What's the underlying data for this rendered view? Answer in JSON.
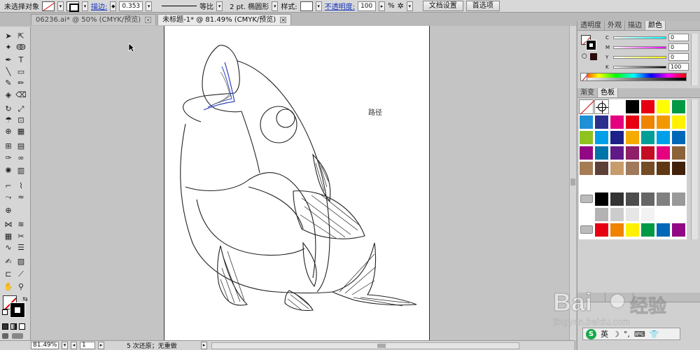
{
  "control_bar": {
    "selection_status": "未选择对象",
    "stroke_label": "描边:",
    "stroke_weight": "0.353",
    "stroke_style": "等比",
    "brush_size": "2 pt. 椭圆形",
    "style_label": "样式:",
    "opacity_label": "不透明度:",
    "opacity_value": "100",
    "opacity_unit": "%",
    "doc_setup_button": "文档设置",
    "preferences_button": "首选项"
  },
  "doc_tabs": [
    {
      "label": "06236.ai* @ 50% (CMYK/预览)",
      "active": false
    },
    {
      "label": "未标题-1* @ 81.49% (CMYK/预览)",
      "active": true
    }
  ],
  "canvas": {
    "path_label": "路径"
  },
  "status_bar": {
    "zoom": "81.49%",
    "page": "1",
    "message": "5 次还原；无重做"
  },
  "panels": {
    "top_tabs": [
      "透明度",
      "外观",
      "描边",
      "颜色"
    ],
    "color_channels": [
      {
        "label": "C",
        "value": "0"
      },
      {
        "label": "M",
        "value": "0"
      },
      {
        "label": "Y",
        "value": "0"
      },
      {
        "label": "K",
        "value": "100"
      }
    ],
    "pct": "%",
    "swatch_tabs": [
      "渐变",
      "色板"
    ],
    "swatch_colors": [
      "#ffffff",
      "#000000",
      "#e60012",
      "#ffff00",
      "#009944",
      "#1e90d6",
      "#2b2e8c",
      "#e4007f",
      "#e60012",
      "#f08300",
      "#f29900",
      "#fff100",
      "#8fc31f",
      "#00a0e9",
      "#1d2088",
      "#f6ab00",
      "#009e96",
      "#00a0e9",
      "#0068b7",
      "#920783",
      "#0075a9",
      "#601986",
      "#8e1f68",
      "#c30d23",
      "#e4007f",
      "#8c6239",
      "#a67c52",
      "#5d4037",
      "#c69c6d",
      "#a0785a",
      "#754c24",
      "#603813",
      "#42210b"
    ],
    "gray_row": [
      "#000000",
      "#333333",
      "#4d4d4d",
      "#666666",
      "#808080",
      "#999999"
    ],
    "gray_row2": [
      "#b3b3b3",
      "#cccccc",
      "#e6e6e6",
      "#f2f2f2"
    ],
    "bright_row": [
      "#e60012",
      "#f08300",
      "#fff100",
      "#009944",
      "#0068b7",
      "#920783"
    ]
  },
  "ime": {
    "lang": "英"
  },
  "watermark": {
    "text": "Bai 经验",
    "url": "jingyan.baidu.com"
  }
}
